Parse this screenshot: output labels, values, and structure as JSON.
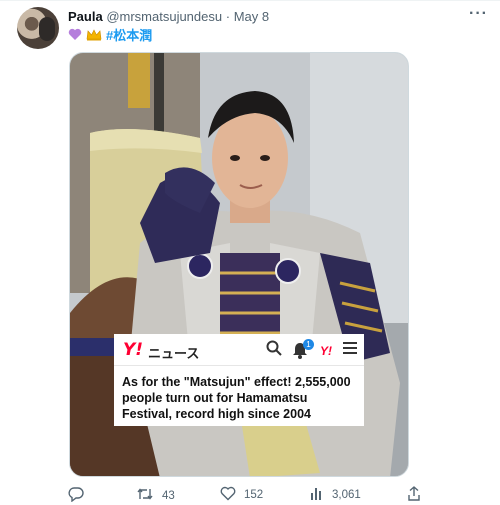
{
  "tweet": {
    "author_name": "Paula",
    "handle": "@mrsmatsujundesu",
    "separator": "·",
    "date": "May 8",
    "more_icon": "more-icon",
    "more_label": "···",
    "hashtag": "#松本潤"
  },
  "news": {
    "logo": "Y!",
    "news_label": "ニュース",
    "badge_count": "1",
    "logo_small": "Y!",
    "headline": "As for the \"Matsujun\" effect! 2,555,000 people turn out for Hamamatsu Festival, record high since 2004"
  },
  "actions": {
    "replies": "",
    "retweets": "43",
    "likes": "152",
    "views": "3,061"
  },
  "colors": {
    "accent": "#1d9bf0",
    "yahoo_red": "#ff0033",
    "secondary_text": "#536471"
  }
}
